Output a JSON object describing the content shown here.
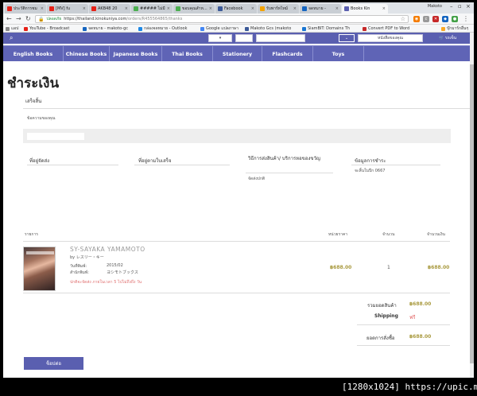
{
  "browser": {
    "tabs": [
      {
        "title": "ประวัติการชม",
        "color": "#e62117"
      },
      {
        "title": "[MV] fu",
        "color": "#e62117"
      },
      {
        "title": "AKB48 20",
        "color": "#e62117"
      },
      {
        "title": "##### ไม่มี",
        "color": "#4caf50"
      },
      {
        "title": "ขอบคุณสำหรับ",
        "color": "#4caf50"
      },
      {
        "title": "Facebook",
        "color": "#3b5998"
      },
      {
        "title": "รับพาร์ทไทม์",
        "color": "#f4a300"
      },
      {
        "title": "จดหมาย - ",
        "color": "#1565c0"
      },
      {
        "title": "Books Kin",
        "color": "#5a5fb0"
      }
    ],
    "user": "Makoto",
    "secure_label": "ปลอดภัย",
    "url_host": "https://thailand.kinokuniya.com",
    "url_path": "/orders/R455564865/thanks",
    "bookmarks": [
      {
        "label": "แอป",
        "color": "#888"
      },
      {
        "label": "YouTube - Broadcast",
        "color": "#e62117"
      },
      {
        "label": "จดหมาย - makoto-gc",
        "color": "#1565c0"
      },
      {
        "label": "กล่องจดหมาย - Outlook",
        "color": "#1e88e5"
      },
      {
        "label": "Google แปลภาษา",
        "color": "#4285f4"
      },
      {
        "label": "Makoto Gcs (makoto",
        "color": "#3b5998"
      },
      {
        "label": "SiamBIT: Domains Th",
        "color": "#1976d2"
      },
      {
        "label": "Convert PDF to Word",
        "color": "#c62828"
      },
      {
        "label": "บุ๊กมาร์กอื่นๆ",
        "color": "#f9a825"
      }
    ]
  },
  "site": {
    "header_select": "หนังสือของคุณ",
    "header_cart": "รถเข็น",
    "categories": [
      "English Books",
      "Chinese Books",
      "Japanese Books",
      "Thai Books",
      "Stationery",
      "Flashcards",
      "Toys"
    ]
  },
  "page": {
    "title": "ชำระเงิน",
    "status": "เสร็จสิ้น",
    "your_message": "ข้อความของคุณ",
    "columns": [
      {
        "label": "ที่อยู่จัดส่ง",
        "sub": ""
      },
      {
        "label": "ที่อยู่ตามใบเสร็จ",
        "sub": ""
      },
      {
        "label": "วิธีการส่งสินค้า/ บริการหอของขวัญ",
        "sub": "จัดส่งปกติ"
      },
      {
        "label": "ข้อมูลการชำระ",
        "sub": "จะสิ้นในปีก 0667"
      }
    ],
    "table": {
      "col_item": "รายการ",
      "col_price": "หน่วยราคา",
      "col_qty": "จำนวน",
      "col_total": "จำนวนเงิน"
    },
    "item": {
      "title": "SY-SAYAKA YAMAMOTO",
      "by": "by レスリー・キー",
      "published_label": "วันที่พิมพ์:",
      "published_value": "2015/02",
      "publisher_label": "สำนักพิมพ์:",
      "publisher_value": "ヨシモトブックス",
      "note": "ปกติจะจัดส่ง ภายในเวลา 5 ไปไม่ถึงถึง วัน",
      "price": "฿688.00",
      "qty": "1",
      "total": "฿688.00"
    },
    "summary": {
      "subtotal_label": "รวมยอดสินค้า",
      "subtotal_value": "฿688.00",
      "shipping_label": "Shipping",
      "shipping_value": "ฟรี",
      "order_total_label": "ยอดการสั่งซื้อ",
      "order_total_value": "฿688.00"
    },
    "back_button": "ช็อปต่อ"
  },
  "watermark": "[1280x1024] https://upic.me/"
}
